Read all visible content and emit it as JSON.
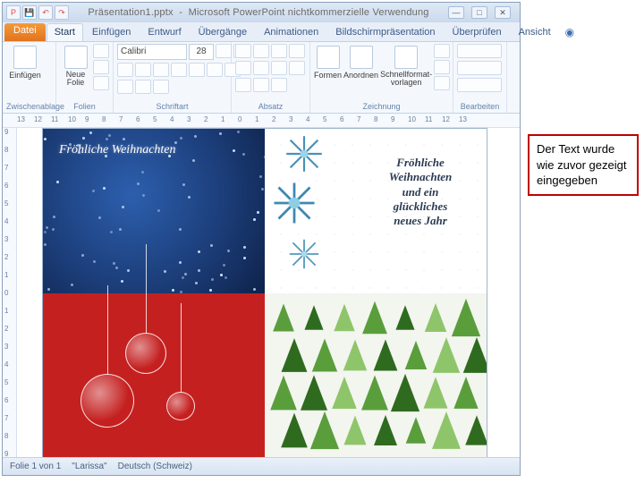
{
  "titlebar": {
    "document": "Präsentation1.pptx",
    "app": "Microsoft PowerPoint nichtkommerzielle Verwendung"
  },
  "tabs": {
    "file": "Datei",
    "items": [
      "Start",
      "Einfügen",
      "Entwurf",
      "Übergänge",
      "Animationen",
      "Bildschirmpräsentation",
      "Überprüfen",
      "Ansicht"
    ],
    "active": 0
  },
  "ribbon": {
    "clipboard": {
      "paste": "Einfügen",
      "label": "Zwischenablage"
    },
    "slides": {
      "newslide": "Neue\nFolie",
      "label": "Folien"
    },
    "font": {
      "name": "Calibri",
      "size": "28",
      "label": "Schriftart"
    },
    "paragraph": {
      "label": "Absatz"
    },
    "drawing": {
      "shapes": "Formen",
      "arrange": "Anordnen",
      "quickstyles": "Schnellformat-\nvorlagen",
      "label": "Zeichnung"
    },
    "editing": {
      "label": "Bearbeiten"
    }
  },
  "ruler_h": [
    "13",
    "12",
    "11",
    "10",
    "9",
    "8",
    "7",
    "6",
    "5",
    "4",
    "3",
    "2",
    "1",
    "0",
    "1",
    "2",
    "3",
    "4",
    "5",
    "6",
    "7",
    "8",
    "9",
    "10",
    "11",
    "12",
    "13"
  ],
  "ruler_v": [
    "9",
    "8",
    "7",
    "6",
    "5",
    "4",
    "3",
    "2",
    "1",
    "0",
    "1",
    "2",
    "3",
    "4",
    "5",
    "6",
    "7",
    "8",
    "9"
  ],
  "slide": {
    "q1_text": "Fröhliche Weihnachten",
    "q2_text": "Fröhliche\nWeihnachten\nund ein\nglückliches\nneues Jahr"
  },
  "statusbar": {
    "slide": "Folie 1 von 1",
    "theme": "\"Larissa\"",
    "lang": "Deutsch (Schweiz)"
  },
  "annotation": "Der Text wurde wie zuvor gezeigt eingegeben"
}
